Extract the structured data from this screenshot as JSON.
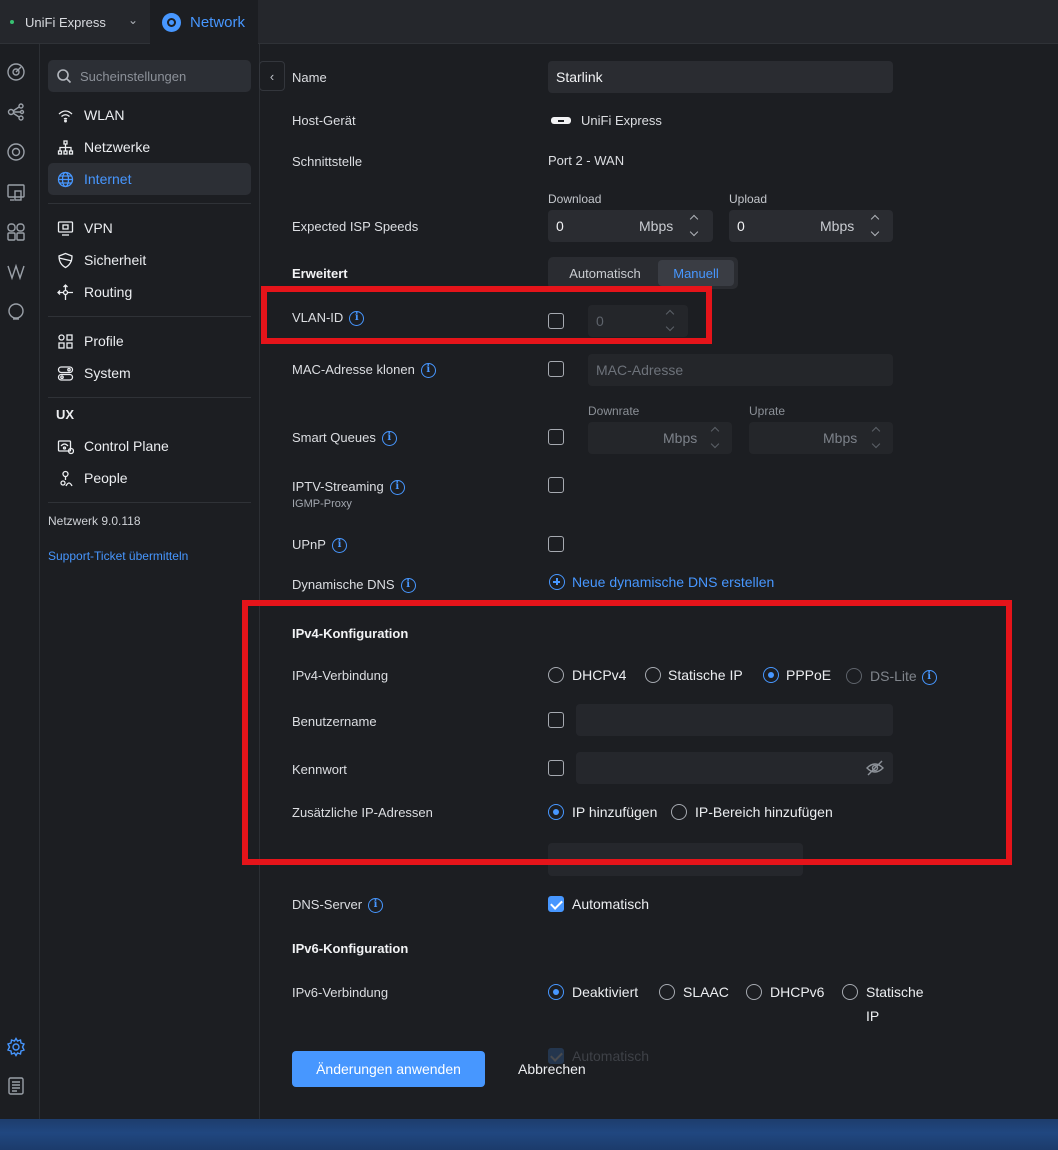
{
  "topbar": {
    "device_name": "UniFi Express",
    "app_name": "Network"
  },
  "sidebar": {
    "search_placeholder": "Sucheinstellungen",
    "groups": [
      [
        {
          "label": "WLAN",
          "icon": "wifi-icon"
        },
        {
          "label": "Netzwerke",
          "icon": "topology-icon"
        },
        {
          "label": "Internet",
          "icon": "globe-icon",
          "active": true
        }
      ],
      [
        {
          "label": "VPN",
          "icon": "vpn-icon"
        },
        {
          "label": "Sicherheit",
          "icon": "shield-icon"
        },
        {
          "label": "Routing",
          "icon": "routing-icon"
        }
      ],
      [
        {
          "label": "Profile",
          "icon": "profiles-icon"
        },
        {
          "label": "System",
          "icon": "system-icon"
        }
      ]
    ],
    "ux_heading": "UX",
    "ux_items": [
      {
        "label": "Control Plane",
        "icon": "control-plane-icon"
      },
      {
        "label": "People",
        "icon": "people-icon"
      }
    ],
    "version": "Netzwerk 9.0.118",
    "support_link": "Support-Ticket übermitteln"
  },
  "form": {
    "name": {
      "label": "Name",
      "value": "Starlink"
    },
    "host_device": {
      "label": "Host-Gerät",
      "value": "UniFi Express"
    },
    "interface": {
      "label": "Schnittstelle",
      "value": "Port 2 - WAN"
    },
    "isp_speeds": {
      "label": "Expected ISP Speeds",
      "download_caption": "Download",
      "download_value": "0",
      "upload_caption": "Upload",
      "upload_value": "0",
      "unit": "Mbps"
    },
    "advanced": {
      "label": "Erweitert",
      "options": [
        "Automatisch",
        "Manuell"
      ],
      "selected": "Manuell"
    },
    "vlan_id": {
      "label": "VLAN-ID",
      "value": "0",
      "checked": false
    },
    "mac_clone": {
      "label": "MAC-Adresse klonen",
      "placeholder": "MAC-Adresse",
      "checked": false
    },
    "smart_queues": {
      "label": "Smart Queues",
      "downrate_caption": "Downrate",
      "uprate_caption": "Uprate",
      "unit": "Mbps",
      "checked": false
    },
    "iptv": {
      "label": "IPTV-Streaming",
      "sublabel": "IGMP-Proxy",
      "checked": false
    },
    "upnp": {
      "label": "UPnP",
      "checked": false
    },
    "dynamic_dns": {
      "label": "Dynamische DNS",
      "action": "Neue dynamische DNS erstellen"
    },
    "ipv4": {
      "heading": "IPv4-Konfiguration",
      "connection_label": "IPv4-Verbindung",
      "connection_options": [
        "DHCPv4",
        "Statische IP",
        "PPPoE",
        "DS-Lite"
      ],
      "connection_selected": "PPPoE",
      "username_label": "Benutzername",
      "password_label": "Kennwort",
      "additional_label": "Zusätzliche IP-Adressen",
      "additional_options": [
        "IP hinzufügen",
        "IP-Bereich hinzufügen"
      ],
      "additional_selected": "IP hinzufügen"
    },
    "dns": {
      "label": "DNS-Server",
      "option": "Automatisch",
      "checked": true
    },
    "ipv6": {
      "heading": "IPv6-Konfiguration",
      "connection_label": "IPv6-Verbindung",
      "connection_options": [
        "Deaktiviert",
        "SLAAC",
        "DHCPv6",
        "Statische",
        "IP"
      ],
      "connection_selected": "Deaktiviert",
      "ghost_option": "Automatisch"
    },
    "actions": {
      "apply": "Änderungen anwenden",
      "cancel": "Abbrechen"
    }
  },
  "colors": {
    "accent": "#4797ff",
    "background": "#1c1e22",
    "highlight": "#e5141a"
  }
}
